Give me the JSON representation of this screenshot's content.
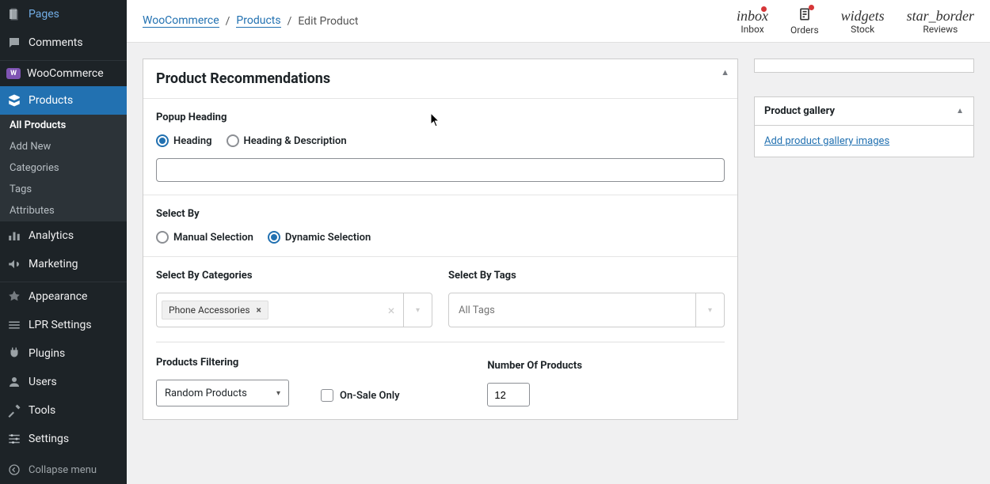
{
  "sidebar": {
    "pages": "Pages",
    "comments": "Comments",
    "woocommerce": "WooCommerce",
    "products": "Products",
    "submenu": {
      "all_products": "All Products",
      "add_new": "Add New",
      "categories": "Categories",
      "tags": "Tags",
      "attributes": "Attributes"
    },
    "analytics": "Analytics",
    "marketing": "Marketing",
    "appearance": "Appearance",
    "lpr_settings": "LPR Settings",
    "plugins": "Plugins",
    "users": "Users",
    "tools": "Tools",
    "settings": "Settings",
    "collapse": "Collapse menu"
  },
  "breadcrumb": {
    "root": "WooCommerce",
    "mid": "Products",
    "current": "Edit Product"
  },
  "topbar": {
    "inbox_icon": "inbox",
    "inbox_label": "Inbox",
    "orders_label": "Orders",
    "widgets_icon": "widgets",
    "stock_label": "Stock",
    "star_icon": "star_border",
    "reviews_label": "Reviews"
  },
  "panel": {
    "title": "Product Recommendations",
    "popup_heading": "Popup Heading",
    "radio_heading": "Heading",
    "radio_heading_desc": "Heading & Description",
    "select_by": "Select By",
    "radio_manual": "Manual Selection",
    "radio_dynamic": "Dynamic Selection",
    "select_by_categories": "Select By Categories",
    "category_tag": "Phone Accessories",
    "select_by_tags": "Select By Tags",
    "all_tags_placeholder": "All Tags",
    "products_filtering": "Products Filtering",
    "filtering_selected": "Random Products",
    "on_sale_only": "On-Sale Only",
    "number_of_products": "Number Of Products",
    "num_products_value": "12"
  },
  "gallery": {
    "title": "Product gallery",
    "link": "Add product gallery images"
  }
}
